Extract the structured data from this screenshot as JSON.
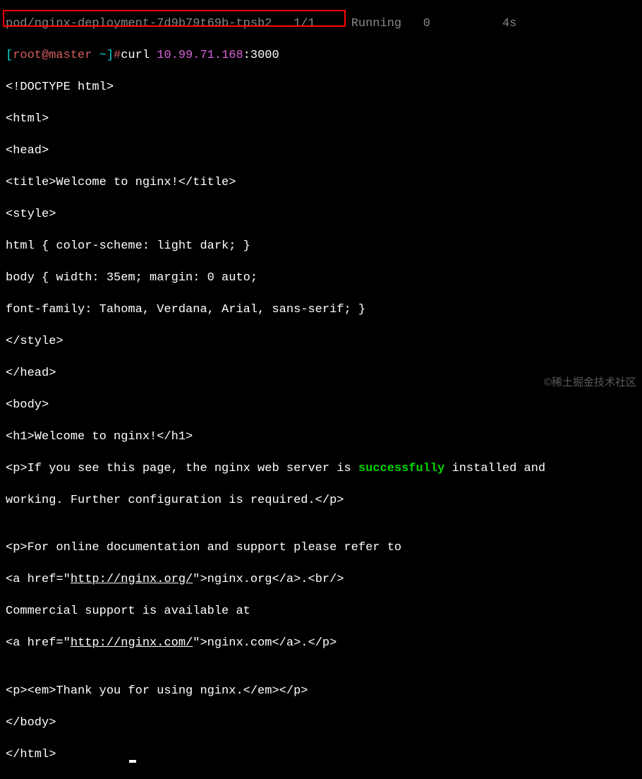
{
  "pod_line": {
    "name": "pod/nginx-deployment-7d9b79t69b-tpsb2",
    "ready": "1/1",
    "status": "Running",
    "restarts": "0",
    "age": "4s"
  },
  "prompt": {
    "bracket_open": "[",
    "user_host": "root@master",
    "tilde": " ~",
    "bracket_close": "]",
    "hash": "#",
    "command": "curl ",
    "ip": "10.99.71.168",
    "port": ":3000"
  },
  "output": {
    "l1": "<!DOCTYPE html>",
    "l2": "<html>",
    "l3": "<head>",
    "l4": "<title>Welcome to nginx!</title>",
    "l5": "<style>",
    "l6": "html { color-scheme: light dark; }",
    "l7": "body { width: 35em; margin: 0 auto;",
    "l8": "font-family: Tahoma, Verdana, Arial, sans-serif; }",
    "l9": "</style>",
    "l10": "</head>",
    "l11": "<body>",
    "l12": "<h1>Welcome to nginx!</h1>",
    "l13a": "<p>If you see this page, the nginx web server is ",
    "l13b": "successfully",
    "l13c": " installed and",
    "l14": "working. Further configuration is required.</p>",
    "l15": "",
    "l16": "<p>For online documentation and support please refer to",
    "l17a": "<a href=\"",
    "l17b": "http://nginx.org/",
    "l17c": "\">nginx.org</a>.<br/>",
    "l18": "Commercial support is available at",
    "l19a": "<a href=\"",
    "l19b": "http://nginx.com/",
    "l19c": "\">nginx.com</a>.</p>",
    "l20": "",
    "l21": "<p><em>Thank you for using nginx.</em></p>",
    "l22": "</body>",
    "l23": "</html>"
  },
  "watermark": "©稀土掘金技术社区"
}
